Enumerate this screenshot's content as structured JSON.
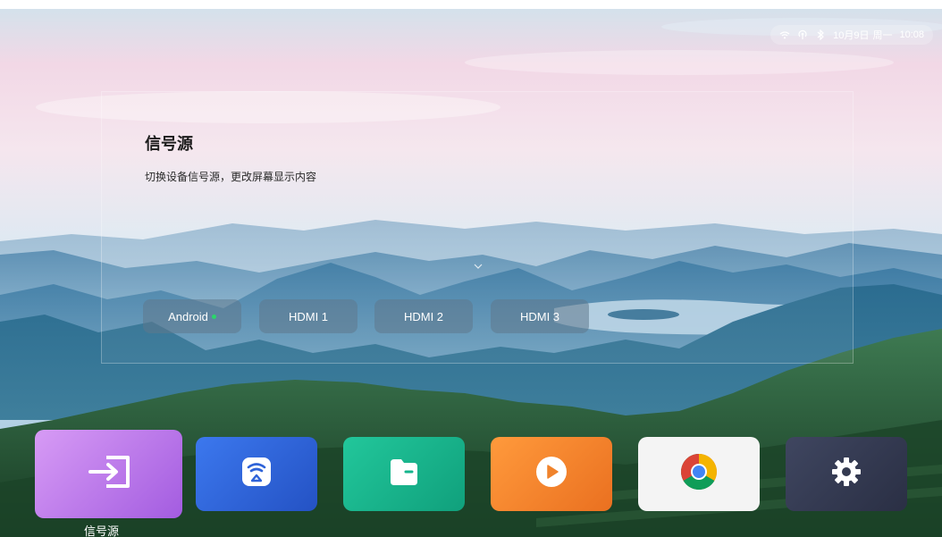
{
  "status_bar": {
    "date": "10月9日",
    "weekday": "周一",
    "time": "10:08",
    "icons": [
      "wifi-icon",
      "hotspot-icon",
      "bluetooth-icon"
    ]
  },
  "panel": {
    "title": "信号源",
    "subtitle": "切换设备信号源，更改屏幕显示内容",
    "sources": [
      {
        "label": "Android",
        "active": true
      },
      {
        "label": "HDMI 1",
        "active": false
      },
      {
        "label": "HDMI 2",
        "active": false
      },
      {
        "label": "HDMI 3",
        "active": false
      }
    ]
  },
  "dock": {
    "focused_label": "信号源",
    "apps": [
      {
        "name": "signal-source",
        "icon": "input-arrow-icon",
        "color": "#c47ef0"
      },
      {
        "name": "screen-cast",
        "icon": "cast-icon",
        "color": "#2f63d8"
      },
      {
        "name": "files",
        "icon": "folder-icon",
        "color": "#15b48c"
      },
      {
        "name": "video-player",
        "icon": "play-icon",
        "color": "#f0832c"
      },
      {
        "name": "chrome",
        "icon": "chrome-icon",
        "color": "#f2f2f2"
      },
      {
        "name": "settings",
        "icon": "gear-icon",
        "color": "#343a50"
      }
    ]
  },
  "colors": {
    "active_dot": "#2bd66a",
    "sky_top": "#f2d8e6",
    "mountain": "#2f6f94",
    "forest": "#1e4f2e"
  }
}
